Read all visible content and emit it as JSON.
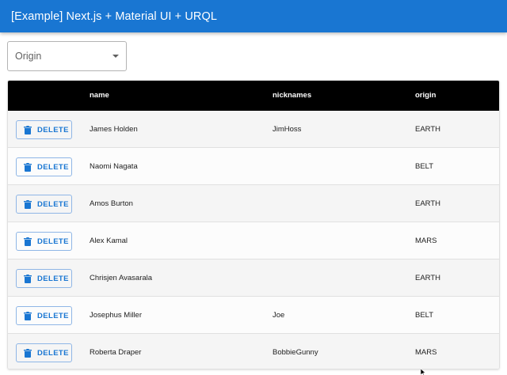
{
  "appbar": {
    "title": "[Example] Next.js + Material UI + URQL"
  },
  "filter": {
    "label": "Origin"
  },
  "table": {
    "headers": {
      "actions": "",
      "name": "name",
      "nicknames": "nicknames",
      "origin": "origin"
    },
    "delete_label": "DELETE",
    "rows": [
      {
        "name": "James Holden",
        "nicknames": "JimHoss",
        "origin": "EARTH"
      },
      {
        "name": "Naomi Nagata",
        "nicknames": "",
        "origin": "BELT"
      },
      {
        "name": "Amos Burton",
        "nicknames": "",
        "origin": "EARTH"
      },
      {
        "name": "Alex Kamal",
        "nicknames": "",
        "origin": "MARS"
      },
      {
        "name": "Chrisjen Avasarala",
        "nicknames": "",
        "origin": "EARTH"
      },
      {
        "name": "Josephus Miller",
        "nicknames": "Joe",
        "origin": "BELT"
      },
      {
        "name": "Roberta Draper",
        "nicknames": "BobbieGunny",
        "origin": "MARS"
      }
    ]
  },
  "colors": {
    "primary": "#1976d2",
    "header_bg": "#000000",
    "row_odd": "#f5f5f5"
  },
  "icons": {
    "delete": "trash-icon",
    "select": "chevron-down-icon"
  }
}
